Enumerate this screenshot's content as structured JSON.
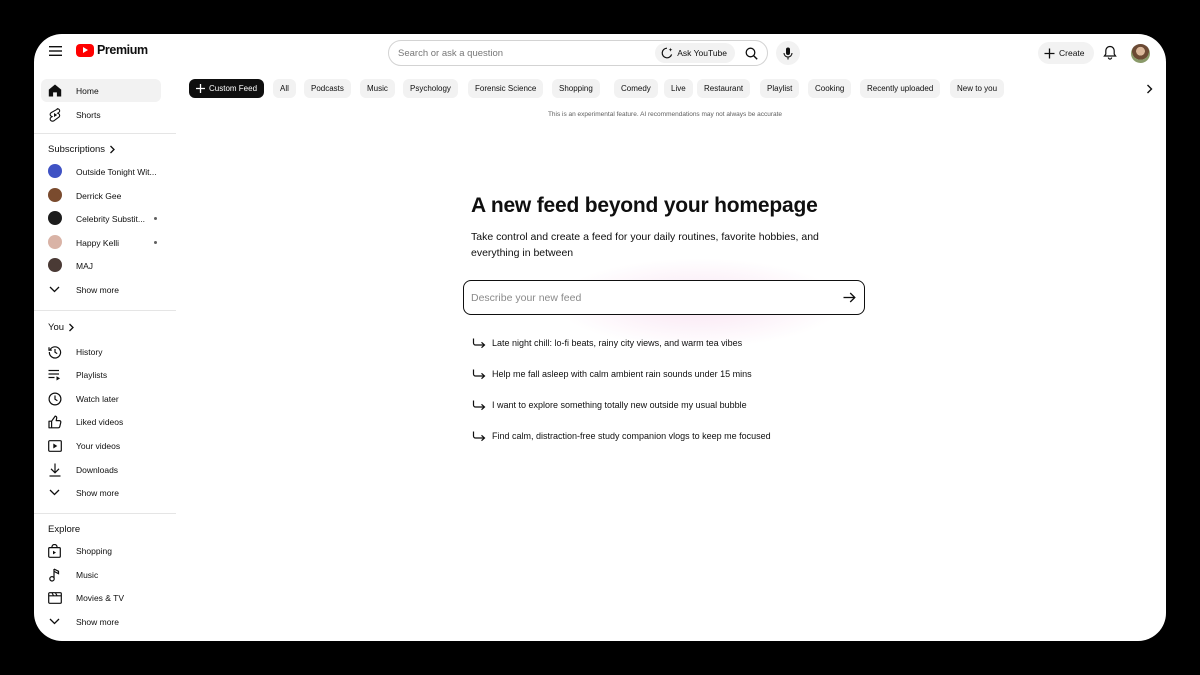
{
  "header": {
    "logo_text": "Premium",
    "search_placeholder": "Search or ask a question",
    "ask_label": "Ask YouTube",
    "create_label": "Create"
  },
  "sidebar": {
    "main": [
      {
        "label": "Home",
        "icon": "home-icon",
        "active": true
      },
      {
        "label": "Shorts",
        "icon": "shorts-icon"
      }
    ],
    "subscriptions_heading": "Subscriptions",
    "subscriptions": [
      {
        "label": "Outside Tonight Wit...",
        "color": "#3f52c4"
      },
      {
        "label": "Derrick Gee",
        "color": "#7a4b2e"
      },
      {
        "label": "Celebrity Substit...",
        "color": "#1c1c1c",
        "dot": true
      },
      {
        "label": "Happy Kelli",
        "color": "#d9b3a6",
        "dot": true
      },
      {
        "label": "MAJ",
        "color": "#4a3a35"
      }
    ],
    "subscriptions_more": "Show more",
    "you_heading": "You",
    "you": [
      {
        "label": "History",
        "icon": "history-icon"
      },
      {
        "label": "Playlists",
        "icon": "playlists-icon"
      },
      {
        "label": "Watch later",
        "icon": "clock-icon"
      },
      {
        "label": "Liked videos",
        "icon": "thumbs-up-icon"
      },
      {
        "label": "Your videos",
        "icon": "video-icon"
      },
      {
        "label": "Downloads",
        "icon": "download-icon"
      }
    ],
    "you_more": "Show more",
    "explore_heading": "Explore",
    "explore": [
      {
        "label": "Shopping",
        "icon": "shopping-bag-icon"
      },
      {
        "label": "Music",
        "icon": "music-note-icon"
      },
      {
        "label": "Movies & TV",
        "icon": "film-icon"
      }
    ],
    "explore_more": "Show more"
  },
  "chips": [
    "Custom Feed",
    "All",
    "Podcasts",
    "Music",
    "Psychology",
    "Forensic Science",
    "Shopping",
    "Comedy",
    "Live",
    "Restaurant",
    "Playlist",
    "Cooking",
    "Recently uploaded",
    "New to you"
  ],
  "disclaimer": "This is an experimental feature. AI recommendations may not always be accurate",
  "hero": {
    "title": "A new feed beyond your homepage",
    "subtitle": "Take control and create a feed for your daily routines, favorite hobbies, and everything in between",
    "input_placeholder": "Describe your new feed"
  },
  "suggestions": [
    "Late night chill: lo-fi beats, rainy city views, and warm tea vibes",
    "Help me fall asleep with calm ambient rain sounds under 15 mins",
    "I want to explore something totally new outside my usual bubble",
    "Find calm, distraction-free study companion vlogs to keep me focused"
  ],
  "colors": {
    "brand_red": "#ff0000",
    "chip_bg": "#f2f2f2",
    "chip_active": "#0f0f0f"
  }
}
